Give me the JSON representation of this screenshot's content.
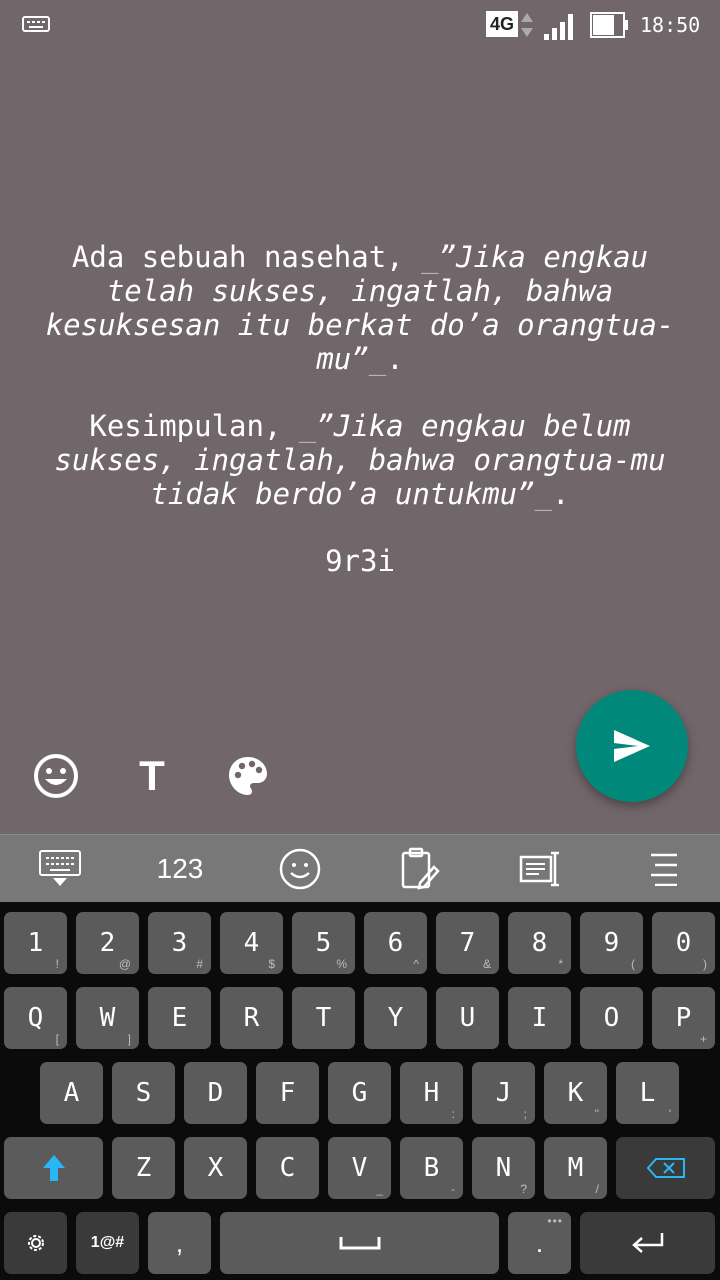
{
  "status_bar": {
    "network": "4G",
    "time": "18:50"
  },
  "message": {
    "line1_plain": "Ada sebuah nasehat, ",
    "line1_mark_open": "_",
    "line1_italic": "”Jika engkau telah sukses, ingatlah, bahwa kesuksesan itu berkat do’a orangtua-mu”",
    "line1_mark_close": "_",
    "line1_end": ".",
    "line2_plain": "Kesimpulan, ",
    "line2_mark_open": "_",
    "line2_italic": "”Jika engkau belum sukses, ingatlah, bahwa orangtua-mu tidak berdo’a untukmu”",
    "line2_mark_close": "_",
    "line2_end": ".",
    "signature": "9r3i"
  },
  "tools": {
    "text_tool": "T"
  },
  "keyboard_toolbar": {
    "numbers_label": "123"
  },
  "keyboard": {
    "row1": [
      {
        "main": "1",
        "sub": "!"
      },
      {
        "main": "2",
        "sub": "@"
      },
      {
        "main": "3",
        "sub": "#"
      },
      {
        "main": "4",
        "sub": "$"
      },
      {
        "main": "5",
        "sub": "%"
      },
      {
        "main": "6",
        "sub": "^"
      },
      {
        "main": "7",
        "sub": "&"
      },
      {
        "main": "8",
        "sub": "*"
      },
      {
        "main": "9",
        "sub": "("
      },
      {
        "main": "0",
        "sub": ")"
      }
    ],
    "row2": [
      {
        "main": "Q",
        "subl": "["
      },
      {
        "main": "W",
        "sub": "]"
      },
      {
        "main": "E",
        "sub": ""
      },
      {
        "main": "R",
        "sub": ""
      },
      {
        "main": "T",
        "sub": ""
      },
      {
        "main": "Y",
        "sub": ""
      },
      {
        "main": "U",
        "sub": ""
      },
      {
        "main": "I",
        "sub": ""
      },
      {
        "main": "O",
        "sub": ""
      },
      {
        "main": "P",
        "sub": "+"
      }
    ],
    "row3": [
      {
        "main": "A",
        "sub": ""
      },
      {
        "main": "S",
        "sub": ""
      },
      {
        "main": "D",
        "sub": ""
      },
      {
        "main": "F",
        "sub": ""
      },
      {
        "main": "G",
        "sub": ""
      },
      {
        "main": "H",
        "sub": ":"
      },
      {
        "main": "J",
        "sub": ";"
      },
      {
        "main": "K",
        "sub": "\""
      },
      {
        "main": "L",
        "sub": "'"
      }
    ],
    "row4": [
      {
        "main": "Z",
        "sub": ""
      },
      {
        "main": "X",
        "sub": ""
      },
      {
        "main": "C",
        "sub": ""
      },
      {
        "main": "V",
        "sub": "_"
      },
      {
        "main": "B",
        "sub": "-"
      },
      {
        "main": "N",
        "sub": "?"
      },
      {
        "main": "M",
        "sub": "/"
      }
    ],
    "symbols_label": "1@#",
    "comma": ",",
    "period": "."
  },
  "colors": {
    "background": "#716669",
    "send_button": "#00897b",
    "shift_accent": "#29b6f6"
  }
}
